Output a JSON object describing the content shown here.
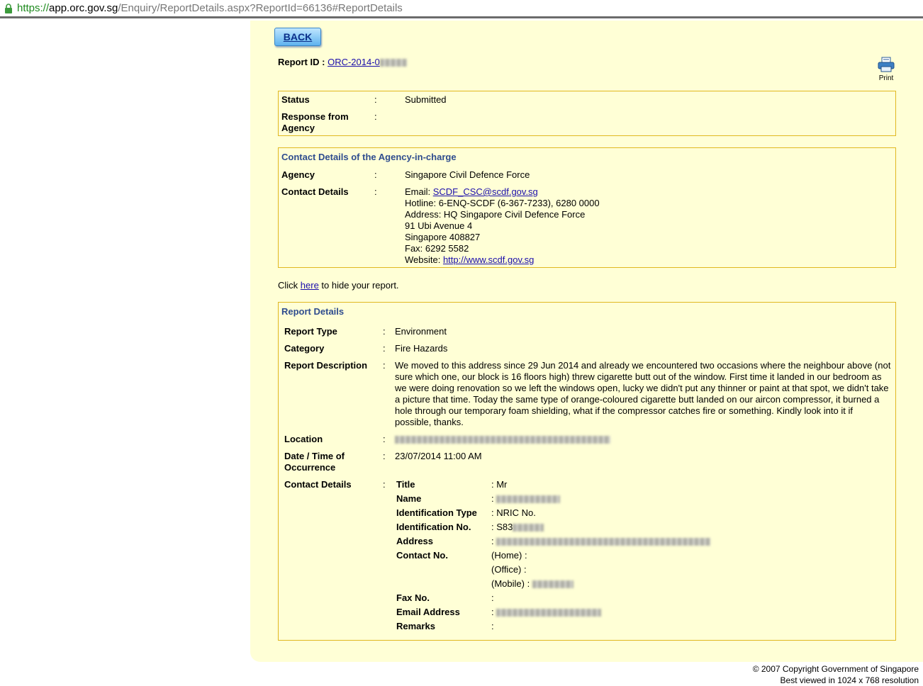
{
  "browser": {
    "url_scheme": "https://",
    "url_host": "app.orc.gov.sg",
    "url_path": "/Enquiry/ReportDetails.aspx?ReportId=66136#ReportDetails"
  },
  "back_label": "BACK",
  "report_id": {
    "label": "Report ID :",
    "value": "ORC-2014-0"
  },
  "print_label": "Print",
  "status_box": {
    "status_label": "Status",
    "status_value": "Submitted",
    "response_label": "Response from Agency"
  },
  "agency_box": {
    "title": "Contact Details of the Agency-in-charge",
    "agency_label": "Agency",
    "agency_value": "Singapore Civil Defence Force",
    "contact_label": "Contact Details",
    "email_prefix": "Email: ",
    "email": "SCDF_CSC@scdf.gov.sg",
    "hotline": "Hotline: 6-ENQ-SCDF (6-367-7233), 6280 0000",
    "address_1": "Address: HQ Singapore Civil Defence Force",
    "address_2": "91 Ubi Avenue 4",
    "address_3": "Singapore 408827",
    "fax": "Fax: 6292 5582",
    "website_prefix": "Website: ",
    "website": "http://www.scdf.gov.sg"
  },
  "hide_line": {
    "prefix": "Click ",
    "link": "here",
    "suffix": " to hide your report."
  },
  "report_details": {
    "title": "Report Details",
    "type_label": "Report Type",
    "type_value": "Environment",
    "category_label": "Category",
    "category_value": "Fire Hazards",
    "description_label": "Report Description",
    "description_value": "We moved to this address since 29 Jun 2014 and already we encountered two occasions where the neighbour above (not sure which one, our block is 16 floors high) threw cigarette butt out of the window. First time it landed in our bedroom as we were doing renovation so we left the windows open, lucky we didn't put any thinner or paint at that spot, we didn't take a picture that time. Today the same type of orange-coloured cigarette butt landed on our aircon compressor, it burned a hole through our temporary foam shielding, what if the compressor catches fire or something. Kindly look into it if possible, thanks.",
    "location_label": "Location",
    "datetime_label": "Date / Time of Occurrence",
    "datetime_value": "23/07/2014 11:00 AM",
    "contact_label": "Contact Details",
    "contact": {
      "title_label": "Title",
      "title_value": ": Mr",
      "name_label": "Name",
      "name_value": ":",
      "idtype_label": "Identification Type",
      "idtype_value": ": NRIC No.",
      "idno_label": "Identification No.",
      "idno_value": ": S83",
      "address_label": "Address",
      "address_value": ":",
      "contactno_label": "Contact No.",
      "home": "(Home) :",
      "office": "(Office) :",
      "mobile": "(Mobile) :",
      "fax_label": "Fax No.",
      "fax_value": ":",
      "email_label": "Email Address",
      "email_value": ":",
      "remarks_label": "Remarks",
      "remarks_value": ":"
    }
  },
  "footer": {
    "copyright": "© 2007 Copyright Government of Singapore",
    "resolution": "Best viewed in 1024 x 768 resolution"
  }
}
